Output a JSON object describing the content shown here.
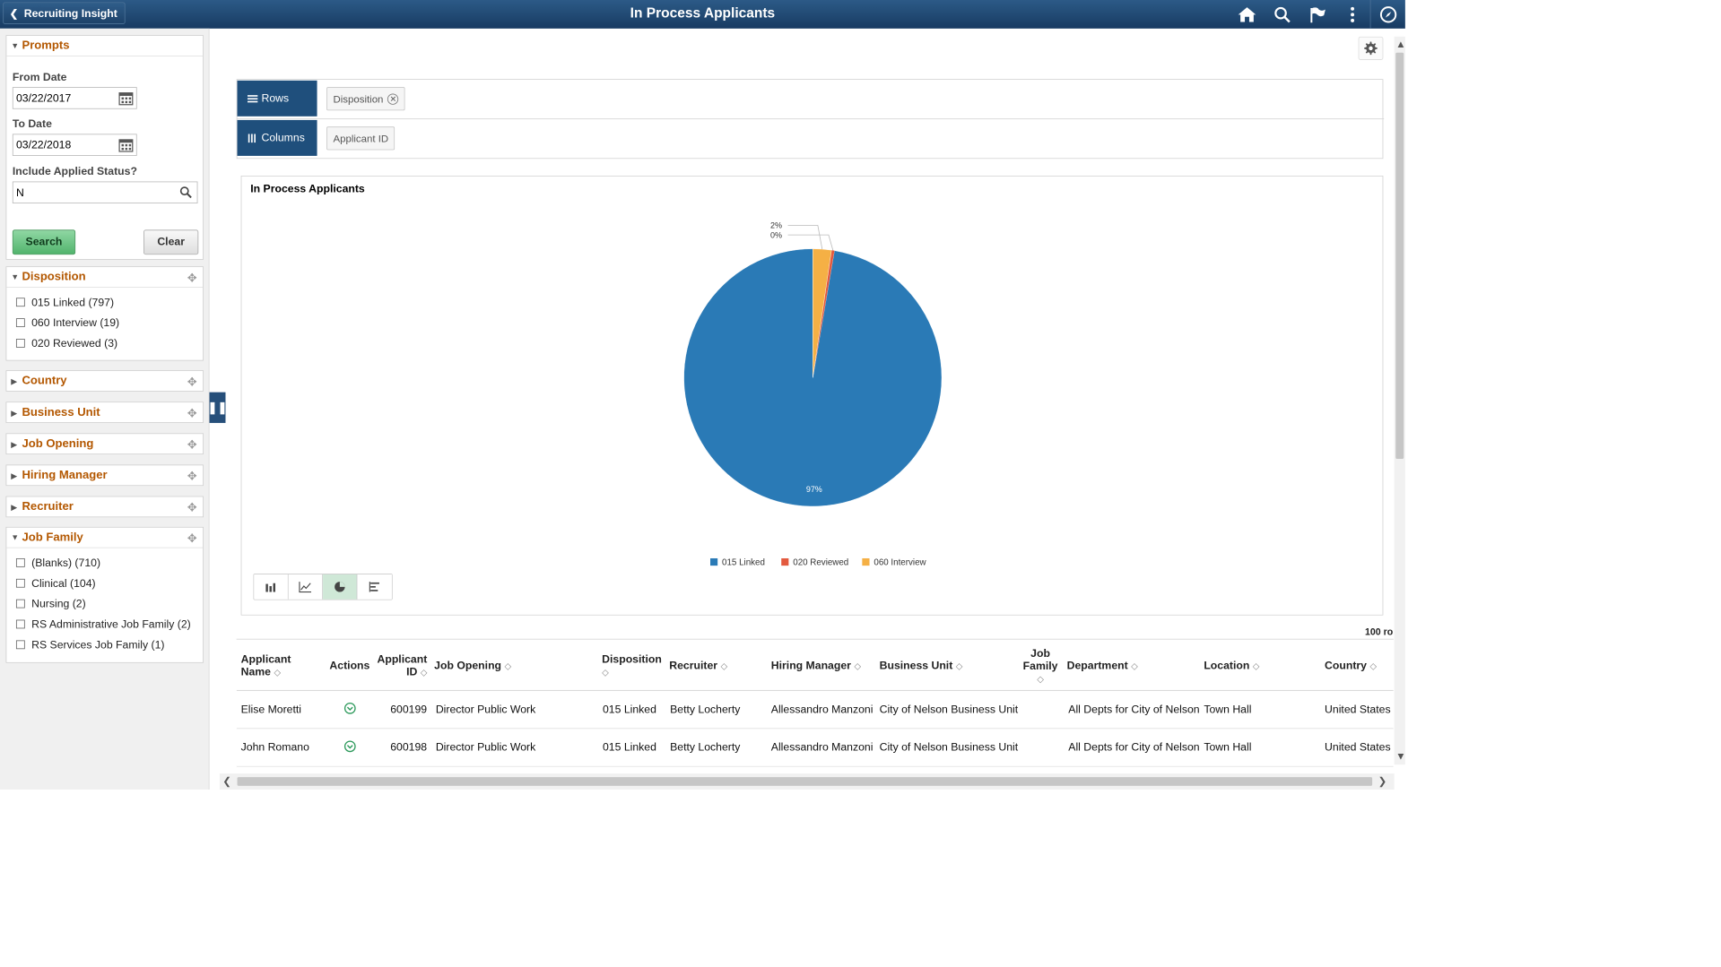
{
  "header": {
    "back_label": "Recruiting Insight",
    "title": "In Process Applicants",
    "icons": [
      "home-icon",
      "search-icon",
      "flag-icon",
      "more-vertical-icon",
      "compass-icon"
    ]
  },
  "prompts": {
    "title": "Prompts",
    "from_date_label": "From Date",
    "from_date": "03/22/2017",
    "to_date_label": "To Date",
    "to_date": "03/22/2018",
    "applied_label": "Include Applied Status?",
    "applied_value": "N",
    "search_label": "Search",
    "clear_label": "Clear"
  },
  "facets": {
    "disposition": {
      "title": "Disposition",
      "items": [
        "015 Linked (797)",
        "060 Interview (19)",
        "020 Reviewed (3)"
      ]
    },
    "country": {
      "title": "Country"
    },
    "business_unit": {
      "title": "Business Unit"
    },
    "job_opening": {
      "title": "Job Opening"
    },
    "hiring_manager": {
      "title": "Hiring Manager"
    },
    "recruiter": {
      "title": "Recruiter"
    },
    "job_family": {
      "title": "Job Family",
      "items": [
        "(Blanks) (710)",
        "Clinical (104)",
        "Nursing (2)",
        "RS Administrative Job Family (2)",
        "RS Services Job Family (1)"
      ]
    }
  },
  "pivot": {
    "rows_label": "Rows",
    "rows_chip": "Disposition",
    "columns_label": "Columns",
    "columns_chip": "Applicant ID"
  },
  "chart_data": {
    "type": "pie",
    "title": "In Process Applicants",
    "categories": [
      "015 Linked",
      "020 Reviewed",
      "060 Interview"
    ],
    "values": [
      797,
      3,
      19
    ],
    "percent_labels": [
      "97%",
      "0%",
      "2%"
    ],
    "colors": [
      "#2a7ab6",
      "#e35a3f",
      "#f5b045"
    ],
    "legend": "bottom-center"
  },
  "chart_types": [
    "bar-chart-icon",
    "line-chart-icon",
    "pie-chart-icon",
    "horizontal-bar-chart-icon"
  ],
  "table": {
    "row_count": "100 ro",
    "headers": {
      "name_1": "Applicant",
      "name_2": "Name",
      "actions": "Actions",
      "id_1": "Applicant",
      "id_2": "ID",
      "job_opening": "Job Opening",
      "disposition": "Disposition",
      "recruiter": "Recruiter",
      "hiring_manager": "Hiring Manager",
      "business_unit": "Business Unit",
      "job_family_1": "Job",
      "job_family_2": "Family",
      "department": "Department",
      "location": "Location",
      "country": "Country"
    },
    "rows": [
      {
        "name": "Elise Moretti",
        "id": "600199",
        "job_opening": "Director Public Work",
        "disposition": "015 Linked",
        "recruiter": "Betty Locherty",
        "hiring_manager": "Allessandro Manzoni",
        "business_unit": "City of Nelson Business Unit",
        "job_family": "",
        "department": "All Depts for City of Nelson",
        "location": "Town Hall",
        "country": "United States"
      },
      {
        "name": "John Romano",
        "id": "600198",
        "job_opening": "Director Public Work",
        "disposition": "015 Linked",
        "recruiter": "Betty Locherty",
        "hiring_manager": "Allessandro Manzoni",
        "business_unit": "City of Nelson Business Unit",
        "job_family": "",
        "department": "All Depts for City of Nelson",
        "location": "Town Hall",
        "country": "United States"
      }
    ]
  }
}
